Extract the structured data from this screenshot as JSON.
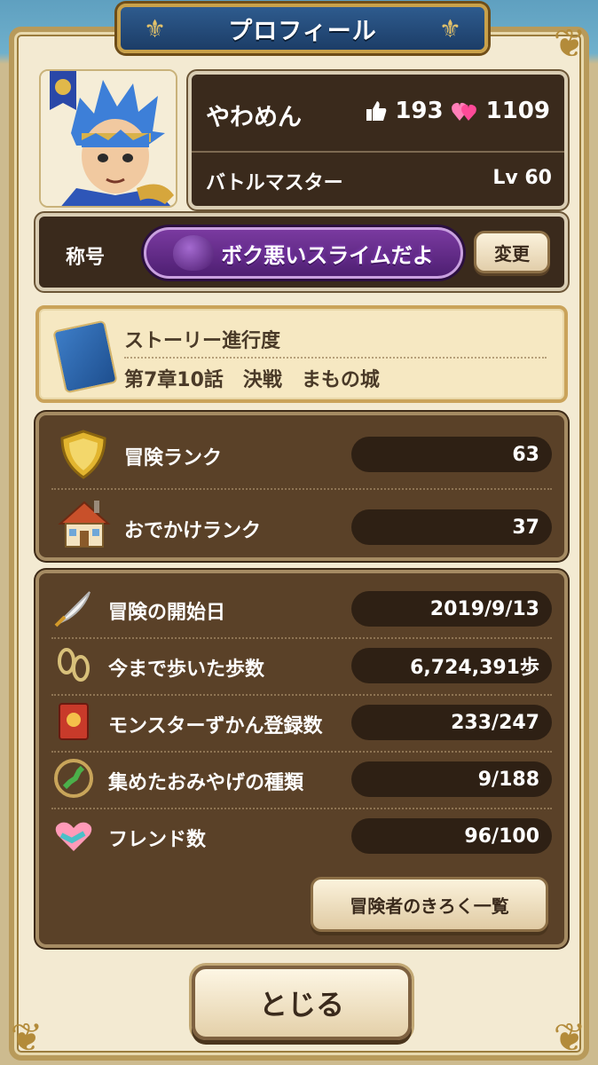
{
  "header": {
    "title": "プロフィール"
  },
  "player": {
    "name": "やわめん",
    "likes": "193",
    "hearts": "1109",
    "job": "バトルマスター",
    "level": "Lv 60"
  },
  "title_section": {
    "label": "称号",
    "title": "ボク悪いスライムだよ",
    "change_button": "変更"
  },
  "story": {
    "heading": "ストーリー進行度",
    "progress": "第7章10話　決戦　まもの城"
  },
  "ranks": [
    {
      "label": "冒険ランク",
      "value": "63",
      "icon": "shield-icon"
    },
    {
      "label": "おでかけランク",
      "value": "37",
      "icon": "house-icon"
    }
  ],
  "stats": [
    {
      "label": "冒険の開始日",
      "value": "2019/9/13",
      "icon": "quill-icon"
    },
    {
      "label": "今まで歩いた歩数",
      "value": "6,724,391歩",
      "icon": "footprints-icon"
    },
    {
      "label": "モンスターずかん登録数",
      "value": "233/247",
      "icon": "monster-book-icon"
    },
    {
      "label": "集めたおみやげの種類",
      "value": "9/188",
      "icon": "japan-map-icon"
    },
    {
      "label": "フレンド数",
      "value": "96/100",
      "icon": "handshake-icon"
    }
  ],
  "buttons": {
    "records": "冒険者のきろく一覧",
    "close": "とじる"
  }
}
